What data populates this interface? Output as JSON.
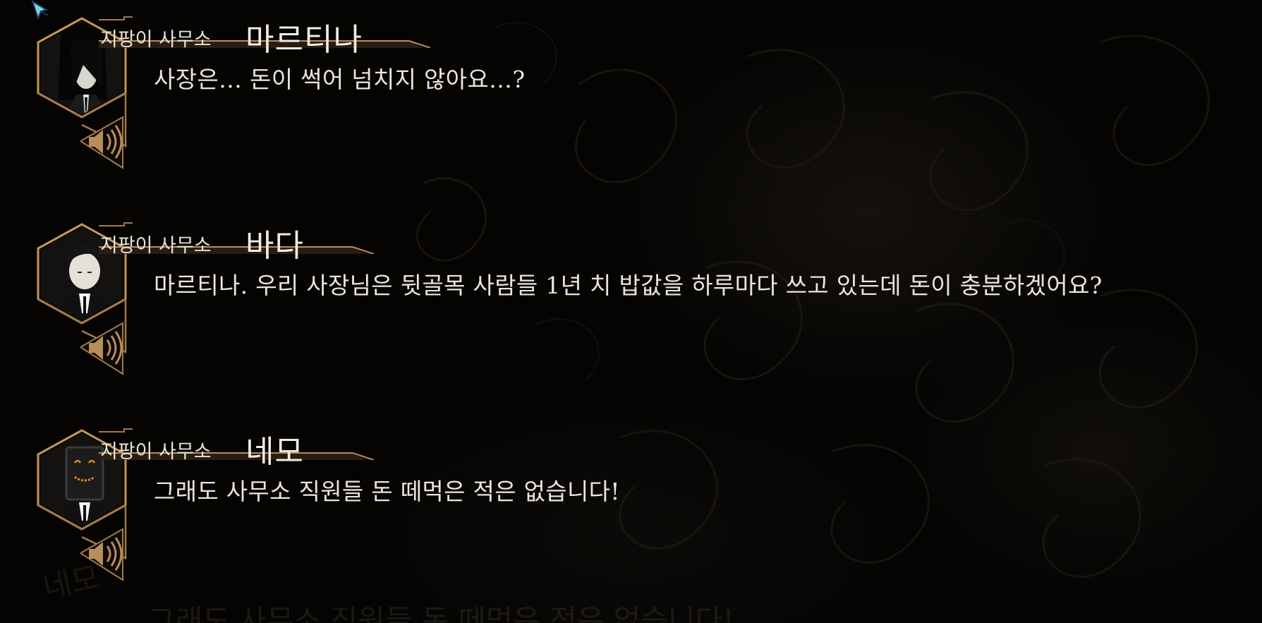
{
  "log": {
    "entries": [
      {
        "affiliation": "지팡이 사무소",
        "name": "마르티나",
        "text": "사장은… 돈이 썩어 넘치지 않아요…?"
      },
      {
        "affiliation": "지팡이 사무소",
        "name": "바다",
        "text": "마르티나. 우리 사장님은 뒷골목 사람들 1년 치 밥값을 하루마다 쓰고 있는데 돈이 충분하겠어요?"
      },
      {
        "affiliation": "지팡이 사무소",
        "name": "네모",
        "text": "그래도 사무소 직원들 돈 떼먹은 적은 없습니다!"
      }
    ]
  },
  "background": {
    "ghost_name": "네모",
    "ghost_line": "그래도 사무소 직원들 돈 떼먹은 적은 없습니다!"
  },
  "colors": {
    "frame_gold": "#a07a4a",
    "frame_glow": "#d9a860",
    "text": "#ebe6da",
    "background": "#050403"
  },
  "icons": {
    "voice_replay": "speaker-icon",
    "cursor": "mouse-cursor-icon"
  }
}
